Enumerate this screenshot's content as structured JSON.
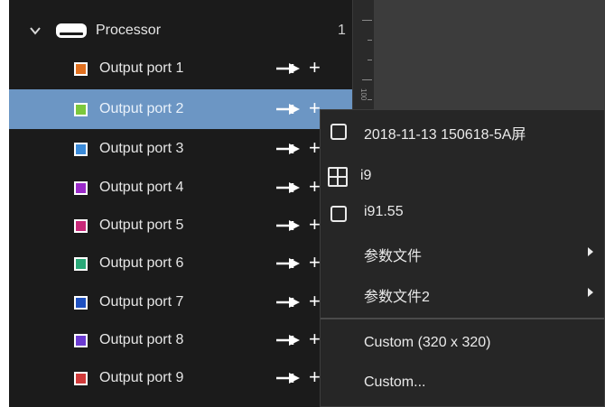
{
  "processor": {
    "label": "Processor",
    "count": "1"
  },
  "ports": [
    {
      "label": "Output port 1",
      "color": "#e07020"
    },
    {
      "label": "Output port 2",
      "color": "#7cc83c"
    },
    {
      "label": "Output port 3",
      "color": "#3a8ad8"
    },
    {
      "label": "Output port 4",
      "color": "#9a2ac8"
    },
    {
      "label": "Output port 5",
      "color": "#c82878"
    },
    {
      "label": "Output port 6",
      "color": "#2aa878"
    },
    {
      "label": "Output port 7",
      "color": "#1e50c0"
    },
    {
      "label": "Output port 8",
      "color": "#6a3ad0"
    },
    {
      "label": "Output port 9",
      "color": "#d03a3a"
    }
  ],
  "selected_port": "Output port 2",
  "ruler": {
    "label": "100"
  },
  "menu": {
    "items": [
      {
        "label": "2018-11-13 150618-5A屏",
        "icon": "checkbox-icon"
      },
      {
        "label": "i9",
        "icon": "grid-icon"
      },
      {
        "label": "i91.55",
        "icon": "checkbox-icon"
      },
      {
        "label": "参数文件",
        "submenu": true
      },
      {
        "label": "参数文件2",
        "submenu": true
      },
      {
        "label": "Custom (320 x 320)"
      },
      {
        "label": "Custom..."
      }
    ]
  }
}
